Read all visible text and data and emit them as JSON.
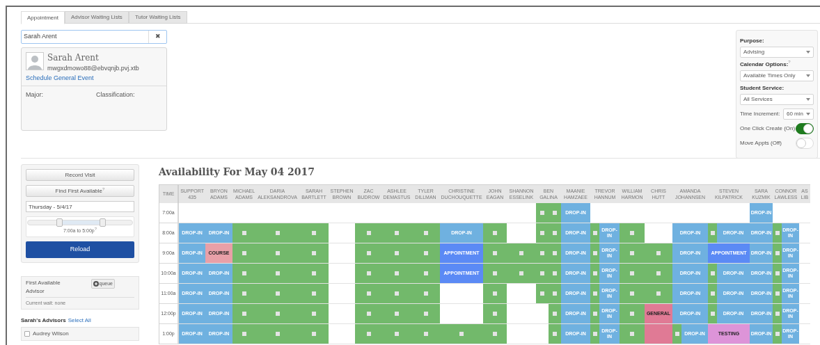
{
  "tabs": [
    {
      "label": "Appointment",
      "selected": true
    },
    {
      "label": "Advisor Waiting Lists",
      "selected": false
    },
    {
      "label": "Tutor Waiting Lists",
      "selected": false
    }
  ],
  "student_search": {
    "value": "Sarah Arent",
    "clear": "✖"
  },
  "student_card": {
    "name": "Sarah Arent",
    "email": "mwgxdmowo88@ebvqnjb.pvj.xtb",
    "link": "Schedule General Event",
    "fields": [
      {
        "label": "Major:"
      },
      {
        "label": "Classification:"
      }
    ]
  },
  "options_panel": {
    "purpose": {
      "label": "Purpose:",
      "value": "Advising"
    },
    "calendar_options": {
      "label": "Calendar Options:",
      "hint": "?",
      "value": "Available Times Only"
    },
    "student_service": {
      "label": "Student Service:",
      "value": "All Services"
    },
    "time_increment": {
      "label": "Time Increment:",
      "value": "60 min"
    },
    "toggles": [
      {
        "label": "One Click Create (On)",
        "on": true
      },
      {
        "label": "Move Appts (Off)",
        "on": false
      }
    ]
  },
  "controls": {
    "record_visit": "Record Visit",
    "find_first": "Find First Available",
    "find_hint": "?",
    "date": "Thursday - 5/4/17",
    "time_range": {
      "thumbs": [
        {
          "level": 0.3
        },
        {
          "level": 0.71
        }
      ],
      "reading": "7:00a to 5:00p",
      "hint": "?"
    },
    "reload": "Reload"
  },
  "queue": {
    "title": "First Available Advisor",
    "button": "queue",
    "wait": "Current wait: none"
  },
  "advisors": {
    "heading": "Sarah's Advisors",
    "select_all": "Select All",
    "items": [
      {
        "name": "Audrey Wilson",
        "checked": false
      }
    ]
  },
  "calendar": {
    "title": "Availability For May 04 2017",
    "time_header": "TIME",
    "columns": [
      "SUPPORT 435",
      "BRYON ADAMS",
      "MICHAEL ADAMS",
      "DARIA ALEKSANDROVA",
      "SARAH BARTLETT",
      "STEPHEN BROWN",
      "ZAC BUDROW",
      "ASHLEE DEMASTUS",
      "TYLER DILLMAN",
      "CHRISTINE DUCHOUQUETTE",
      "JOHN EAGAN",
      "SHANNON ESSELINK",
      "BEN GALINA",
      "MAANIE HAMZAEE",
      "TREVOR HANNUM",
      "WILLIAM HARMON",
      "CHRIS HUTT",
      "AMANDA JOHANNSEN",
      "STEVEN KILPATRICK",
      "SARA KUZMIK",
      "CONNOR LAWLESS",
      "AS LIB"
    ],
    "rows": [
      {
        "time": "7:00a",
        "cells": [
          [
            {
              "kind": "empty"
            }
          ],
          [
            {
              "kind": "empty"
            }
          ],
          [
            {
              "kind": "empty"
            }
          ],
          [
            {
              "kind": "empty"
            }
          ],
          [
            {
              "kind": "empty"
            }
          ],
          [
            {
              "kind": "empty"
            }
          ],
          [
            {
              "kind": "empty"
            }
          ],
          [
            {
              "kind": "empty"
            }
          ],
          [
            {
              "kind": "empty"
            }
          ],
          [
            {
              "kind": "empty"
            }
          ],
          [
            {
              "kind": "empty"
            }
          ],
          [
            {
              "kind": "empty"
            }
          ],
          [
            {
              "kind": "open"
            },
            {
              "kind": "open"
            }
          ],
          [
            {
              "kind": "drop-in",
              "label": "DROP-IN"
            }
          ],
          [
            {
              "kind": "empty"
            }
          ],
          [
            {
              "kind": "empty"
            }
          ],
          [
            {
              "kind": "empty"
            }
          ],
          [
            {
              "kind": "empty"
            }
          ],
          [
            {
              "kind": "empty"
            }
          ],
          [
            {
              "kind": "drop-in",
              "label": "DROP-IN"
            }
          ],
          [
            {
              "kind": "empty"
            }
          ],
          [
            {
              "kind": "empty"
            }
          ]
        ]
      },
      {
        "time": "8:00a",
        "cells": [
          [
            {
              "kind": "drop-in",
              "label": "DROP-IN"
            }
          ],
          [
            {
              "kind": "drop-in",
              "label": "DROP-IN"
            }
          ],
          [
            {
              "kind": "open"
            }
          ],
          [
            {
              "kind": "open"
            }
          ],
          [
            {
              "kind": "open"
            }
          ],
          [
            {
              "kind": "empty"
            }
          ],
          [
            {
              "kind": "open"
            }
          ],
          [
            {
              "kind": "open"
            }
          ],
          [
            {
              "kind": "open"
            }
          ],
          [
            {
              "kind": "drop-in",
              "label": "DROP-IN"
            }
          ],
          [
            {
              "kind": "open"
            }
          ],
          [
            {
              "kind": "empty"
            }
          ],
          [
            {
              "kind": "open"
            },
            {
              "kind": "open"
            }
          ],
          [
            {
              "kind": "drop-in",
              "label": "DROP-IN"
            }
          ],
          [
            {
              "kind": "open"
            },
            {
              "kind": "drop-in",
              "label": "DROP-IN"
            }
          ],
          [
            {
              "kind": "open"
            }
          ],
          [
            {
              "kind": "empty"
            }
          ],
          [
            {
              "kind": "drop-in",
              "label": "DROP-IN"
            }
          ],
          [
            {
              "kind": "open"
            },
            {
              "kind": "drop-in",
              "label": "DROP-IN"
            }
          ],
          [
            {
              "kind": "drop-in",
              "label": "DROP-IN"
            }
          ],
          [
            {
              "kind": "open"
            },
            {
              "kind": "drop-in",
              "label": "DROP-IN"
            }
          ],
          [
            {
              "kind": "empty"
            }
          ]
        ]
      },
      {
        "time": "9:00a",
        "cells": [
          [
            {
              "kind": "drop-in",
              "label": "DROP-IN"
            }
          ],
          [
            {
              "kind": "course",
              "label": "COURSE"
            }
          ],
          [
            {
              "kind": "open"
            }
          ],
          [
            {
              "kind": "open"
            }
          ],
          [
            {
              "kind": "open"
            }
          ],
          [
            {
              "kind": "empty"
            }
          ],
          [
            {
              "kind": "open"
            }
          ],
          [
            {
              "kind": "open"
            }
          ],
          [
            {
              "kind": "open"
            }
          ],
          [
            {
              "kind": "appointment",
              "label": "APPOINTMENT"
            }
          ],
          [
            {
              "kind": "open"
            }
          ],
          [
            {
              "kind": "open"
            }
          ],
          [
            {
              "kind": "open"
            },
            {
              "kind": "open"
            }
          ],
          [
            {
              "kind": "drop-in",
              "label": "DROP-IN"
            }
          ],
          [
            {
              "kind": "open"
            },
            {
              "kind": "drop-in",
              "label": "DROP-IN"
            }
          ],
          [
            {
              "kind": "open"
            }
          ],
          [
            {
              "kind": "open"
            }
          ],
          [
            {
              "kind": "drop-in",
              "label": "DROP-IN"
            }
          ],
          [
            {
              "kind": "appointment",
              "label": "APPOINTMENT"
            }
          ],
          [
            {
              "kind": "drop-in",
              "label": "DROP-IN"
            }
          ],
          [
            {
              "kind": "open"
            },
            {
              "kind": "drop-in",
              "label": "DROP-IN"
            }
          ],
          [
            {
              "kind": "empty"
            }
          ]
        ]
      },
      {
        "time": "10:00a",
        "cells": [
          [
            {
              "kind": "drop-in",
              "label": "DROP-IN"
            }
          ],
          [
            {
              "kind": "drop-in",
              "label": "DROP-IN"
            }
          ],
          [
            {
              "kind": "open"
            }
          ],
          [
            {
              "kind": "open"
            }
          ],
          [
            {
              "kind": "open"
            }
          ],
          [
            {
              "kind": "empty"
            }
          ],
          [
            {
              "kind": "open"
            }
          ],
          [
            {
              "kind": "open"
            }
          ],
          [
            {
              "kind": "open"
            }
          ],
          [
            {
              "kind": "appointment",
              "label": "APPOINTMENT"
            }
          ],
          [
            {
              "kind": "open"
            }
          ],
          [
            {
              "kind": "open"
            }
          ],
          [
            {
              "kind": "open"
            },
            {
              "kind": "open"
            }
          ],
          [
            {
              "kind": "drop-in",
              "label": "DROP-IN"
            }
          ],
          [
            {
              "kind": "open"
            },
            {
              "kind": "drop-in",
              "label": "DROP-IN"
            }
          ],
          [
            {
              "kind": "open"
            }
          ],
          [
            {
              "kind": "open"
            }
          ],
          [
            {
              "kind": "drop-in",
              "label": "DROP-IN"
            }
          ],
          [
            {
              "kind": "open"
            },
            {
              "kind": "drop-in",
              "label": "DROP-IN"
            }
          ],
          [
            {
              "kind": "drop-in",
              "label": "DROP-IN"
            }
          ],
          [
            {
              "kind": "open"
            },
            {
              "kind": "drop-in",
              "label": "DROP-IN"
            }
          ],
          [
            {
              "kind": "empty"
            }
          ]
        ]
      },
      {
        "time": "11:00a",
        "cells": [
          [
            {
              "kind": "drop-in",
              "label": "DROP-IN"
            }
          ],
          [
            {
              "kind": "drop-in",
              "label": "DROP-IN"
            }
          ],
          [
            {
              "kind": "open"
            }
          ],
          [
            {
              "kind": "open"
            }
          ],
          [
            {
              "kind": "open"
            }
          ],
          [
            {
              "kind": "empty"
            }
          ],
          [
            {
              "kind": "open"
            }
          ],
          [
            {
              "kind": "open"
            }
          ],
          [
            {
              "kind": "open"
            }
          ],
          [
            {
              "kind": "empty"
            }
          ],
          [
            {
              "kind": "open"
            }
          ],
          [
            {
              "kind": "empty"
            }
          ],
          [
            {
              "kind": "open"
            },
            {
              "kind": "open"
            }
          ],
          [
            {
              "kind": "drop-in",
              "label": "DROP-IN"
            }
          ],
          [
            {
              "kind": "open"
            },
            {
              "kind": "drop-in",
              "label": "DROP-IN"
            }
          ],
          [
            {
              "kind": "open"
            }
          ],
          [
            {
              "kind": "open"
            }
          ],
          [
            {
              "kind": "drop-in",
              "label": "DROP-IN"
            }
          ],
          [
            {
              "kind": "open"
            },
            {
              "kind": "drop-in",
              "label": "DROP-IN"
            }
          ],
          [
            {
              "kind": "drop-in",
              "label": "DROP-IN"
            }
          ],
          [
            {
              "kind": "open"
            },
            {
              "kind": "drop-in",
              "label": "DROP-IN"
            }
          ],
          [
            {
              "kind": "empty"
            }
          ]
        ]
      },
      {
        "time": "12:00p",
        "cells": [
          [
            {
              "kind": "drop-in",
              "label": "DROP-IN"
            }
          ],
          [
            {
              "kind": "drop-in",
              "label": "DROP-IN"
            }
          ],
          [
            {
              "kind": "open"
            }
          ],
          [
            {
              "kind": "open"
            }
          ],
          [
            {
              "kind": "open"
            }
          ],
          [
            {
              "kind": "empty"
            }
          ],
          [
            {
              "kind": "open"
            }
          ],
          [
            {
              "kind": "open"
            }
          ],
          [
            {
              "kind": "open"
            }
          ],
          [
            {
              "kind": "empty"
            }
          ],
          [
            {
              "kind": "open"
            }
          ],
          [
            {
              "kind": "empty"
            }
          ],
          [
            {
              "kind": "empty"
            },
            {
              "kind": "open"
            }
          ],
          [
            {
              "kind": "drop-in",
              "label": "DROP-IN"
            }
          ],
          [
            {
              "kind": "open"
            },
            {
              "kind": "drop-in",
              "label": "DROP-IN"
            }
          ],
          [
            {
              "kind": "open"
            }
          ],
          [
            {
              "kind": "general",
              "label": "GENERAL"
            }
          ],
          [
            {
              "kind": "drop-in",
              "label": "DROP-IN"
            }
          ],
          [
            {
              "kind": "open"
            },
            {
              "kind": "drop-in",
              "label": "DROP-IN"
            }
          ],
          [
            {
              "kind": "drop-in",
              "label": "DROP-IN"
            }
          ],
          [
            {
              "kind": "open"
            },
            {
              "kind": "drop-in",
              "label": "DROP-IN"
            }
          ],
          [
            {
              "kind": "empty"
            }
          ]
        ]
      },
      {
        "time": "1:00p",
        "cells": [
          [
            {
              "kind": "drop-in",
              "label": "DROP-IN"
            }
          ],
          [
            {
              "kind": "drop-in",
              "label": "DROP-IN"
            }
          ],
          [
            {
              "kind": "open"
            }
          ],
          [
            {
              "kind": "open"
            }
          ],
          [
            {
              "kind": "open"
            }
          ],
          [
            {
              "kind": "empty"
            }
          ],
          [
            {
              "kind": "open"
            }
          ],
          [
            {
              "kind": "open"
            }
          ],
          [
            {
              "kind": "open"
            }
          ],
          [
            {
              "kind": "open"
            }
          ],
          [
            {
              "kind": "open"
            }
          ],
          [
            {
              "kind": "empty"
            }
          ],
          [
            {
              "kind": "empty"
            },
            {
              "kind": "open"
            }
          ],
          [
            {
              "kind": "drop-in",
              "label": "DROP-IN"
            }
          ],
          [
            {
              "kind": "open"
            },
            {
              "kind": "drop-in",
              "label": "DROP-IN"
            }
          ],
          [
            {
              "kind": "open"
            }
          ],
          [
            {
              "kind": "general"
            }
          ],
          [
            {
              "kind": "open"
            },
            {
              "kind": "drop-in",
              "label": "DROP-IN"
            }
          ],
          [
            {
              "kind": "testing",
              "label": "TESTING"
            }
          ],
          [
            {
              "kind": "drop-in",
              "label": "DROP-IN"
            }
          ],
          [
            {
              "kind": "open"
            },
            {
              "kind": "drop-in",
              "label": "DROP-IN"
            }
          ],
          [
            {
              "kind": "empty"
            }
          ]
        ]
      }
    ]
  }
}
